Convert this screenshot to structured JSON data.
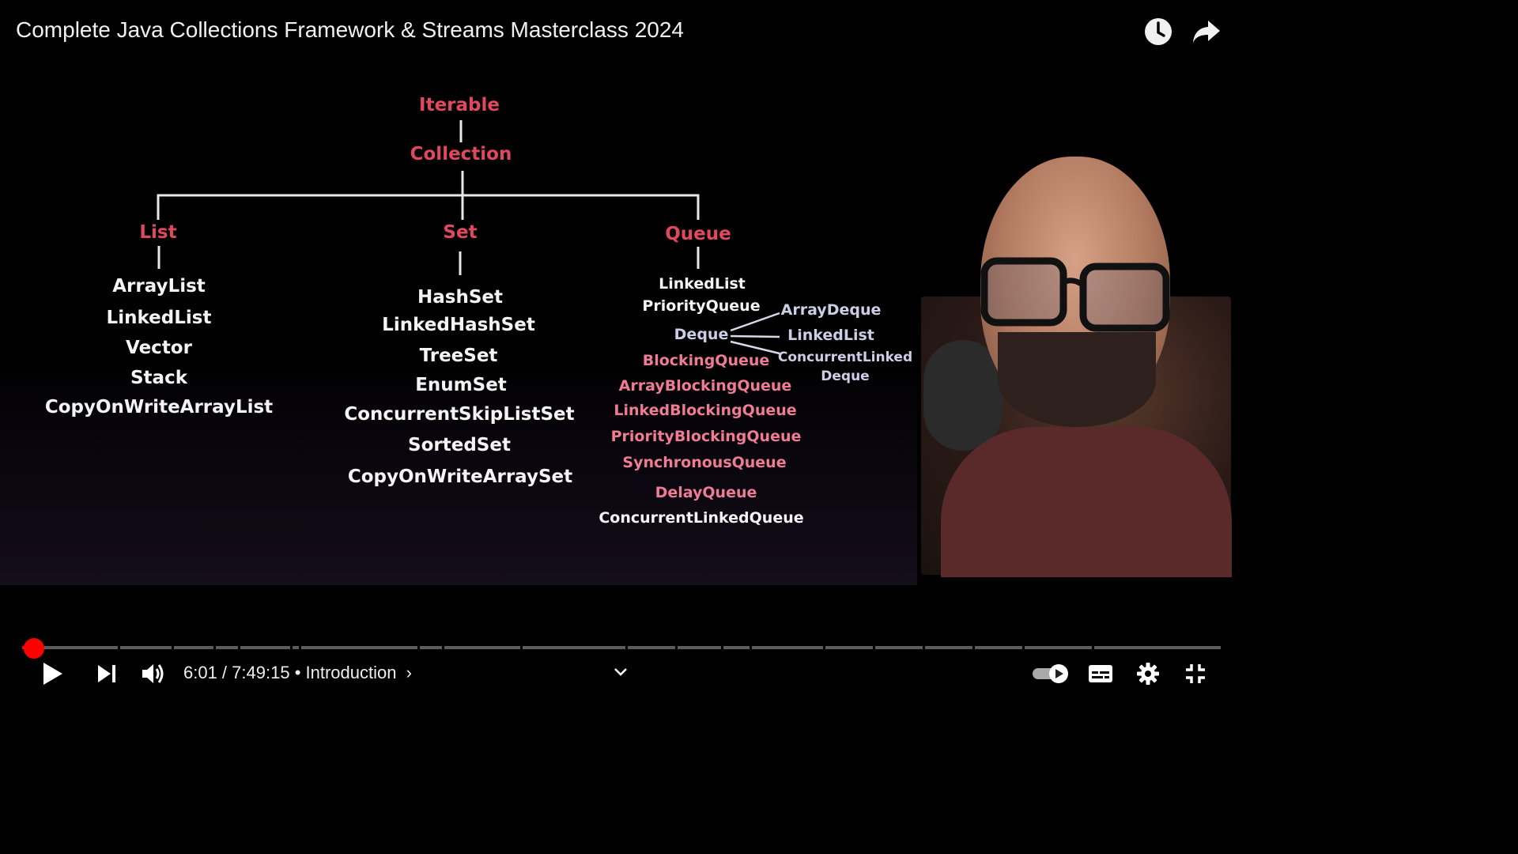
{
  "video": {
    "title": "Complete Java Collections Framework & Streams Masterclass 2024"
  },
  "top_icons": [
    "clock-icon",
    "share-icon"
  ],
  "slide": {
    "root": "Iterable",
    "collection": "Collection",
    "list": {
      "header": "List",
      "items": [
        "ArrayList",
        "LinkedList",
        "Vector",
        "Stack",
        "CopyOnWriteArrayList"
      ]
    },
    "set": {
      "header": "Set",
      "items": [
        "HashSet",
        "LinkedHashSet",
        "TreeSet",
        "EnumSet",
        "ConcurrentSkipListSet",
        "SortedSet",
        "CopyOnWriteArraySet"
      ]
    },
    "queue": {
      "header": "Queue",
      "linkedlist": "LinkedList",
      "priorityqueue": "PriorityQueue",
      "deque": "Deque",
      "deque_children": [
        "ArrayDeque",
        "LinkedList",
        "ConcurrentLinked",
        "Deque"
      ],
      "blockingqueue": "BlockingQueue",
      "blocking_children": [
        "ArrayBlockingQueue",
        "LinkedBlockingQueue",
        "PriorityBlockingQueue",
        "SynchronousQueue"
      ],
      "delayqueue": "DelayQueue",
      "concurrentlinkedqueue": "ConcurrentLinkedQueue"
    }
  },
  "player": {
    "time_display": "6:01 / 7:49:15",
    "separator": "•",
    "chapter": "Introduction",
    "progress_fraction": 0.0006,
    "colors": {
      "progress": "#ff0000",
      "track": "#5c5c5c"
    },
    "icons": [
      "play-icon",
      "next-icon",
      "volume-icon",
      "chevron-down-icon",
      "autoplay-toggle-icon",
      "captions-icon",
      "settings-icon",
      "exit-fullscreen-icon"
    ]
  }
}
